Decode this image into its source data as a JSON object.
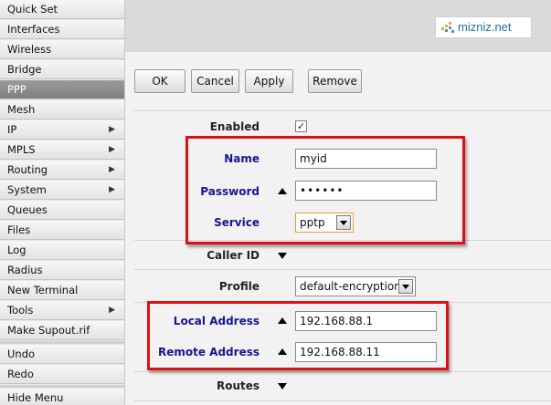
{
  "sidebar": {
    "items": [
      {
        "label": "Quick Set",
        "arrow": false,
        "active": false
      },
      {
        "label": "Interfaces",
        "arrow": false,
        "active": false
      },
      {
        "label": "Wireless",
        "arrow": false,
        "active": false
      },
      {
        "label": "Bridge",
        "arrow": false,
        "active": false
      },
      {
        "label": "PPP",
        "arrow": false,
        "active": true
      },
      {
        "label": "Mesh",
        "arrow": false,
        "active": false
      },
      {
        "label": "IP",
        "arrow": true,
        "active": false
      },
      {
        "label": "MPLS",
        "arrow": true,
        "active": false
      },
      {
        "label": "Routing",
        "arrow": true,
        "active": false
      },
      {
        "label": "System",
        "arrow": true,
        "active": false
      },
      {
        "label": "Queues",
        "arrow": false,
        "active": false
      },
      {
        "label": "Files",
        "arrow": false,
        "active": false
      },
      {
        "label": "Log",
        "arrow": false,
        "active": false
      },
      {
        "label": "Radius",
        "arrow": false,
        "active": false
      },
      {
        "label": "New Terminal",
        "arrow": false,
        "active": false
      },
      {
        "label": "Tools",
        "arrow": true,
        "active": false
      },
      {
        "label": "Make Supout.rif",
        "arrow": false,
        "active": false
      },
      {
        "label": "Undo",
        "arrow": false,
        "active": false
      },
      {
        "label": "Redo",
        "arrow": false,
        "active": false
      },
      {
        "label": "Hide Menu",
        "arrow": false,
        "active": false
      }
    ],
    "arrow_glyph": "▶"
  },
  "brand": {
    "text": "mizniz.net"
  },
  "toolbar": {
    "ok_label": "OK",
    "cancel_label": "Cancel",
    "apply_label": "Apply",
    "remove_label": "Remove"
  },
  "form": {
    "enabled": {
      "label": "Enabled",
      "checked": true,
      "check_glyph": "✓"
    },
    "name": {
      "label": "Name",
      "value": "myid"
    },
    "password": {
      "label": "Password",
      "value": "••••••"
    },
    "service": {
      "label": "Service",
      "value": "pptp"
    },
    "caller_id": {
      "label": "Caller ID"
    },
    "profile": {
      "label": "Profile",
      "value": "default-encryption"
    },
    "local_address": {
      "label": "Local Address",
      "value": "192.168.88.1"
    },
    "remote_address": {
      "label": "Remote Address",
      "value": "192.168.88.11"
    },
    "routes": {
      "label": "Routes"
    }
  },
  "colors": {
    "highlight_border": "#e01010",
    "label_blue": "#16168e",
    "brand_blue": "#1f6fa8",
    "active_menu": "#8a8a8a"
  }
}
